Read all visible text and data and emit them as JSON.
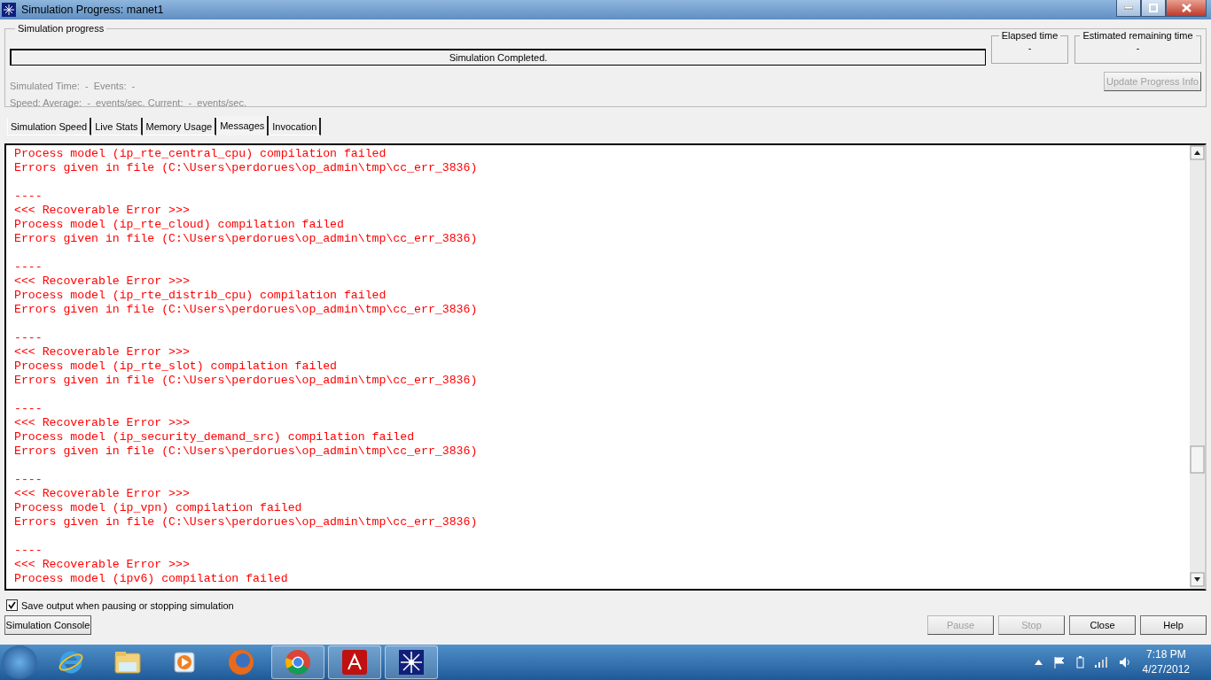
{
  "window": {
    "title": "Simulation Progress: manet1"
  },
  "progress_group": {
    "title": "Simulation progress",
    "status": "Simulation Completed.",
    "level": 0,
    "stats": [
      "Simulated Time:  -  Events:  -",
      "Speed: Average:  -  events/sec. Current:  -  events/sec."
    ],
    "elapsed": {
      "label": "Elapsed time",
      "value": "-"
    },
    "remaining": {
      "label": "Estimated remaining time",
      "value": "-"
    },
    "update_button": {
      "label": "Update Progress Info",
      "disabled": true
    }
  },
  "tabs": [
    {
      "label": "Simulation Speed",
      "selected": false
    },
    {
      "label": "Live Stats",
      "selected": false
    },
    {
      "label": "Memory Usage",
      "selected": false
    },
    {
      "label": "Messages",
      "selected": true
    },
    {
      "label": "Invocation",
      "selected": false
    }
  ],
  "messages": [
    [
      "Process model (ip_rte_central_cpu) compilation failed",
      "Errors given in file (C:\\Users\\perdorues\\op_admin\\tmp\\cc_err_3836)"
    ],
    [
      "----",
      "<<< Recoverable Error >>>",
      "Process model (ip_rte_cloud) compilation failed",
      "Errors given in file (C:\\Users\\perdorues\\op_admin\\tmp\\cc_err_3836)"
    ],
    [
      "----",
      "<<< Recoverable Error >>>",
      "Process model (ip_rte_distrib_cpu) compilation failed",
      "Errors given in file (C:\\Users\\perdorues\\op_admin\\tmp\\cc_err_3836)"
    ],
    [
      "----",
      "<<< Recoverable Error >>>",
      "Process model (ip_rte_slot) compilation failed",
      "Errors given in file (C:\\Users\\perdorues\\op_admin\\tmp\\cc_err_3836)"
    ],
    [
      "----",
      "<<< Recoverable Error >>>",
      "Process model (ip_security_demand_src) compilation failed",
      "Errors given in file (C:\\Users\\perdorues\\op_admin\\tmp\\cc_err_3836)"
    ],
    [
      "----",
      "<<< Recoverable Error >>>",
      "Process model (ip_vpn) compilation failed",
      "Errors given in file (C:\\Users\\perdorues\\op_admin\\tmp\\cc_err_3836)"
    ],
    [
      "----",
      "<<< Recoverable Error >>>",
      "Process model (ipv6) compilation failed"
    ]
  ],
  "save_output": {
    "label": "Save output when pausing or stopping simulation",
    "checked": true
  },
  "console_button": {
    "label": "Simulation Console",
    "disabled": false
  },
  "buttons": [
    {
      "label": "Pause",
      "disabled": true
    },
    {
      "label": "Stop",
      "disabled": true
    },
    {
      "label": "Close",
      "disabled": false
    },
    {
      "label": "Help",
      "disabled": false
    }
  ],
  "taskbar": {
    "apps": [
      {
        "kind": "ie",
        "selected": false
      },
      {
        "kind": "explorer",
        "selected": false
      },
      {
        "kind": "media",
        "selected": false
      },
      {
        "kind": "firefox",
        "selected": false
      },
      {
        "kind": "chrome",
        "selected": true
      },
      {
        "kind": "pdf",
        "selected": true
      },
      {
        "kind": "star",
        "selected": true
      }
    ],
    "time": "7:18 PM",
    "date": "4/27/2012"
  }
}
